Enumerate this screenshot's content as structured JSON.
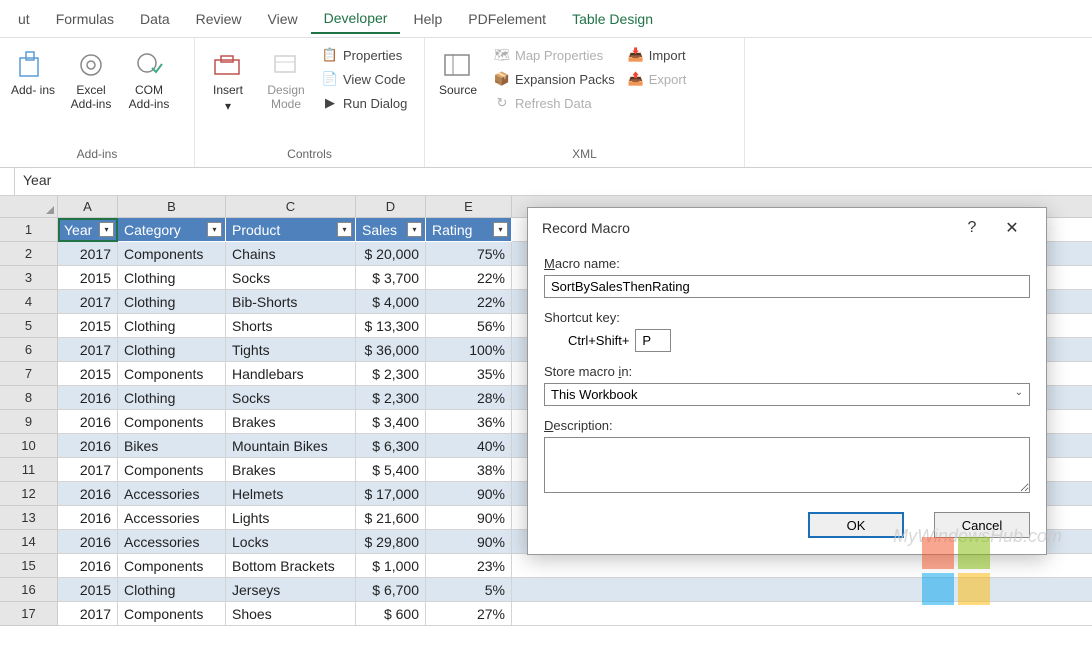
{
  "menu": [
    "ut",
    "Formulas",
    "Data",
    "Review",
    "View",
    "Developer",
    "Help",
    "PDFelement",
    "Table Design"
  ],
  "menu_active_index": 5,
  "menu_special_index": 8,
  "ribbon": {
    "addins": {
      "label": "Add-ins",
      "addins_btn": "Add-\nins",
      "excel_addins_btn": "Excel\nAdd-ins",
      "com_addins_btn": "COM\nAdd-ins"
    },
    "controls": {
      "label": "Controls",
      "insert_btn": "Insert",
      "design_btn": "Design\nMode",
      "properties": "Properties",
      "view_code": "View Code",
      "run_dialog": "Run Dialog"
    },
    "xml": {
      "label": "XML",
      "source_btn": "Source",
      "map_props": "Map Properties",
      "expansion": "Expansion Packs",
      "refresh": "Refresh Data",
      "import": "Import",
      "export": "Export"
    }
  },
  "formula_bar": "Year",
  "columns": [
    "A",
    "B",
    "C",
    "D",
    "E"
  ],
  "headers": [
    "Year",
    "Category",
    "Product",
    "Sales",
    "Rating"
  ],
  "rows": [
    {
      "n": 2,
      "year": "2017",
      "cat": "Components",
      "prod": "Chains",
      "sales": "$ 20,000",
      "rating": "75%"
    },
    {
      "n": 3,
      "year": "2015",
      "cat": "Clothing",
      "prod": "Socks",
      "sales": "$   3,700",
      "rating": "22%"
    },
    {
      "n": 4,
      "year": "2017",
      "cat": "Clothing",
      "prod": "Bib-Shorts",
      "sales": "$   4,000",
      "rating": "22%"
    },
    {
      "n": 5,
      "year": "2015",
      "cat": "Clothing",
      "prod": "Shorts",
      "sales": "$ 13,300",
      "rating": "56%"
    },
    {
      "n": 6,
      "year": "2017",
      "cat": "Clothing",
      "prod": "Tights",
      "sales": "$ 36,000",
      "rating": "100%"
    },
    {
      "n": 7,
      "year": "2015",
      "cat": "Components",
      "prod": "Handlebars",
      "sales": "$   2,300",
      "rating": "35%"
    },
    {
      "n": 8,
      "year": "2016",
      "cat": "Clothing",
      "prod": "Socks",
      "sales": "$   2,300",
      "rating": "28%"
    },
    {
      "n": 9,
      "year": "2016",
      "cat": "Components",
      "prod": "Brakes",
      "sales": "$   3,400",
      "rating": "36%"
    },
    {
      "n": 10,
      "year": "2016",
      "cat": "Bikes",
      "prod": "Mountain Bikes",
      "sales": "$   6,300",
      "rating": "40%"
    },
    {
      "n": 11,
      "year": "2017",
      "cat": "Components",
      "prod": "Brakes",
      "sales": "$   5,400",
      "rating": "38%"
    },
    {
      "n": 12,
      "year": "2016",
      "cat": "Accessories",
      "prod": "Helmets",
      "sales": "$ 17,000",
      "rating": "90%"
    },
    {
      "n": 13,
      "year": "2016",
      "cat": "Accessories",
      "prod": "Lights",
      "sales": "$ 21,600",
      "rating": "90%"
    },
    {
      "n": 14,
      "year": "2016",
      "cat": "Accessories",
      "prod": "Locks",
      "sales": "$ 29,800",
      "rating": "90%"
    },
    {
      "n": 15,
      "year": "2016",
      "cat": "Components",
      "prod": "Bottom Brackets",
      "sales": "$   1,000",
      "rating": "23%"
    },
    {
      "n": 16,
      "year": "2015",
      "cat": "Clothing",
      "prod": "Jerseys",
      "sales": "$   6,700",
      "rating": "5%"
    },
    {
      "n": 17,
      "year": "2017",
      "cat": "Components",
      "prod": "Shoes",
      "sales": "$      600",
      "rating": "27%"
    }
  ],
  "dialog": {
    "title": "Record Macro",
    "name_label": "Macro name:",
    "name_value": "SortBySalesThenRating",
    "shortcut_label": "Shortcut key:",
    "shortcut_prefix": "Ctrl+Shift+",
    "shortcut_value": "P",
    "store_label": "Store macro in:",
    "store_value": "This Workbook",
    "desc_label": "Description:",
    "ok": "OK",
    "cancel": "Cancel"
  },
  "watermark": "MyWindowsHub.com"
}
